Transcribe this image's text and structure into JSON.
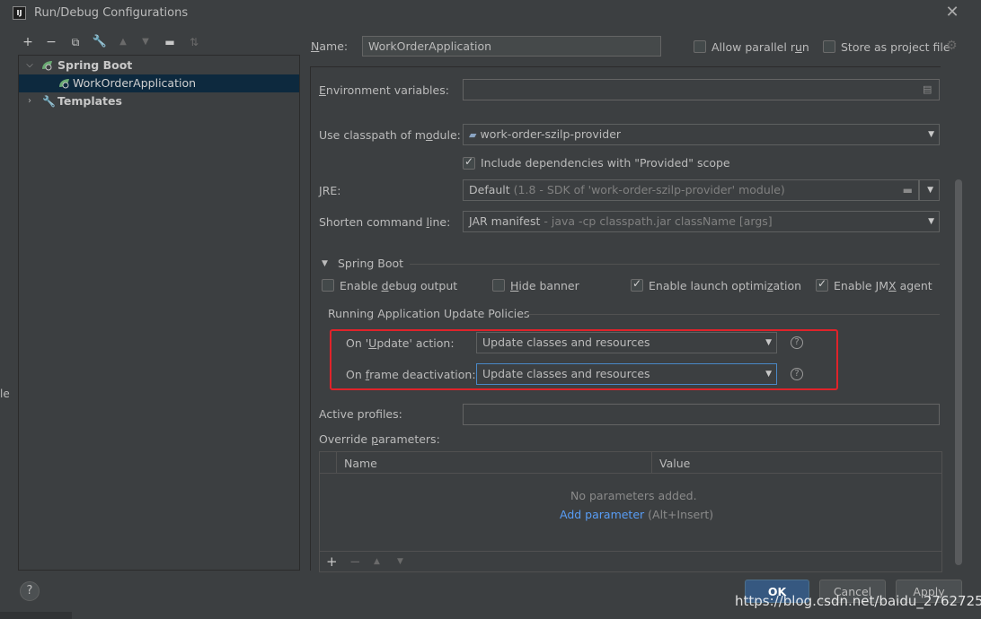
{
  "window": {
    "title": "Run/Debug Configurations",
    "app_icon": "IJ"
  },
  "toolbar": {
    "icons": [
      "add-icon",
      "remove-icon",
      "copy-icon",
      "wrench-icon",
      "move-up-icon",
      "move-down-icon",
      "new-folder-icon",
      "sort-icon"
    ]
  },
  "tree": {
    "group": "Spring Boot",
    "item": "WorkOrderApplication",
    "templates": "Templates"
  },
  "left_edge_text": "le",
  "name": {
    "label_prefix": "N",
    "label_rest": "ame:",
    "value": "WorkOrderApplication",
    "allow_parallel_run": "Allow parallel run",
    "allow_parallel_prefix": "Allow parallel r",
    "allow_parallel_u": "u",
    "allow_parallel_suffix": "n",
    "store_as_project_file": "Store as project file"
  },
  "env": {
    "label_u": "E",
    "label_rest": "nvironment variables:",
    "value": ""
  },
  "classpath": {
    "label_a": "Use classpath of m",
    "label_u": "o",
    "label_b": "dule:",
    "value": "work-order-szilp-provider",
    "include_deps": "Include dependencies with \"Provided\" scope",
    "include_deps_checked": true
  },
  "jre": {
    "label_u": "J",
    "label_rest": "RE:",
    "value_main": "Default",
    "value_detail": "(1.8 - SDK of 'work-order-szilp-provider' module)"
  },
  "shorten": {
    "label_a": "Shorten command ",
    "label_u": "l",
    "label_b": "ine:",
    "value_main": "JAR manifest",
    "value_detail": "- java -cp classpath.jar className [args]"
  },
  "spring_boot": {
    "section_title": "Spring Boot",
    "enable_debug_a": "Enable ",
    "enable_debug_u": "d",
    "enable_debug_b": "ebug output",
    "enable_debug_checked": false,
    "hide_banner_u": "H",
    "hide_banner_rest": "ide banner",
    "hide_banner_checked": false,
    "launch_opt_a": "Enable launch optimi",
    "launch_opt_u": "z",
    "launch_opt_b": "ation",
    "launch_opt_checked": true,
    "jmx_a": "Enable JM",
    "jmx_u": "X",
    "jmx_b": " agent",
    "jmx_checked": true
  },
  "update_policies": {
    "title": "Running Application Update Policies",
    "on_update_a": "On '",
    "on_update_u": "U",
    "on_update_b": "pdate' action:",
    "on_update_value": "Update classes and resources",
    "on_frame_a": "On ",
    "on_frame_u": "f",
    "on_frame_b": "rame deactivation:",
    "on_frame_value": "Update classes and resources"
  },
  "active_profiles": {
    "label": "Active profiles:",
    "value": ""
  },
  "override": {
    "label_a": "Override ",
    "label_u": "p",
    "label_b": "arameters:",
    "col_name": "Name",
    "col_value": "Value",
    "empty_text": "No parameters added.",
    "add_link": "Add parameter",
    "add_shortcut": "(Alt+Insert)"
  },
  "buttons": {
    "ok": "OK",
    "cancel": "Cancel",
    "apply": "Apply"
  },
  "watermark": "https://blog.csdn.net/baidu_27627251",
  "colors": {
    "background": "#3c3f41",
    "accent": "#365880",
    "highlight": "#e0232a",
    "link": "#589df6"
  }
}
